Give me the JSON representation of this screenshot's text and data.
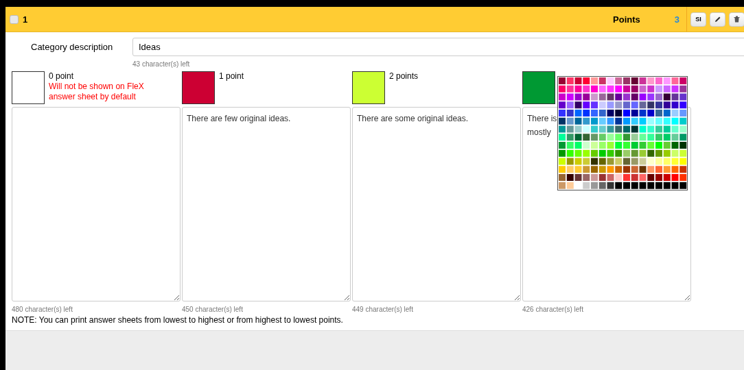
{
  "header": {
    "checked": false,
    "number": "1",
    "points_label": "Points",
    "points_count": "3",
    "buttons": [
      {
        "kind": "text",
        "label": "SI"
      },
      {
        "kind": "edit"
      },
      {
        "kind": "delete"
      }
    ]
  },
  "category": {
    "label": "Category description",
    "value": "Ideas",
    "remaining": "43 character(s) left"
  },
  "levels": [
    {
      "label": "0 point",
      "warning": "Will not be shown on FleX answer sheet by default",
      "color": "#ffffff",
      "remaining": "480 character(s) left"
    },
    {
      "label": "1 point",
      "color": "#cc0033",
      "description": "There are few original ideas.",
      "remaining": "450 character(s) left"
    },
    {
      "label": "2 points",
      "color": "#ccff33",
      "description": "There are some original ideas.",
      "remaining": "449 character(s) left"
    },
    {
      "color": "#009933",
      "description": "There is\nmostly",
      "remaining": "426 character(s) left",
      "palette_open": true
    }
  ],
  "note": "NOTE: You can print answer sheets from lowest to highest or from highest to lowest points."
}
